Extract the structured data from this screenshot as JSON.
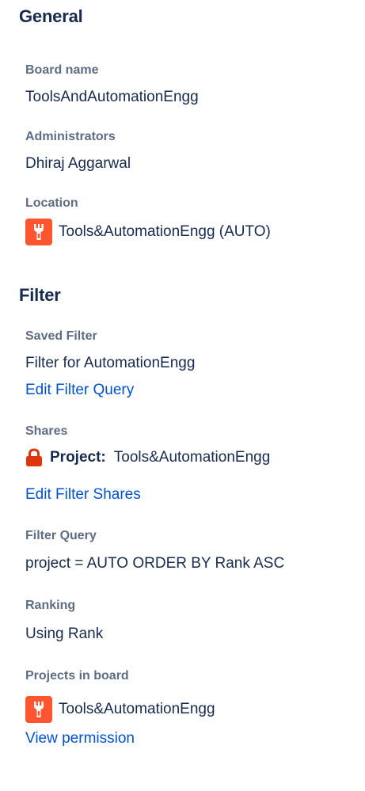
{
  "general": {
    "title": "General",
    "board_name": {
      "label": "Board name",
      "value": "ToolsAndAutomationEngg"
    },
    "administrators": {
      "label": "Administrators",
      "value": "Dhiraj Aggarwal"
    },
    "location": {
      "label": "Location",
      "value": "Tools&AutomationEngg (AUTO)",
      "icon": "project-avatar-icon"
    }
  },
  "filter": {
    "title": "Filter",
    "saved_filter": {
      "label": "Saved Filter",
      "value": "Filter for AutomationEngg",
      "link": "Edit Filter Query"
    },
    "shares": {
      "label": "Shares",
      "type": "Project:",
      "name": "Tools&AutomationEngg",
      "icon": "lock-icon",
      "link": "Edit Filter Shares"
    },
    "filter_query": {
      "label": "Filter Query",
      "value": "project = AUTO ORDER BY Rank ASC"
    },
    "ranking": {
      "label": "Ranking",
      "value": "Using Rank"
    },
    "projects_in_board": {
      "label": "Projects in board",
      "items": [
        {
          "name": "Tools&AutomationEngg",
          "icon": "project-avatar-icon"
        }
      ],
      "link": "View permission"
    }
  },
  "colors": {
    "heading": "#172b4d",
    "label": "#5e6c84",
    "link": "#0052cc",
    "avatar": "#ff5630",
    "lock": "#de350b"
  }
}
